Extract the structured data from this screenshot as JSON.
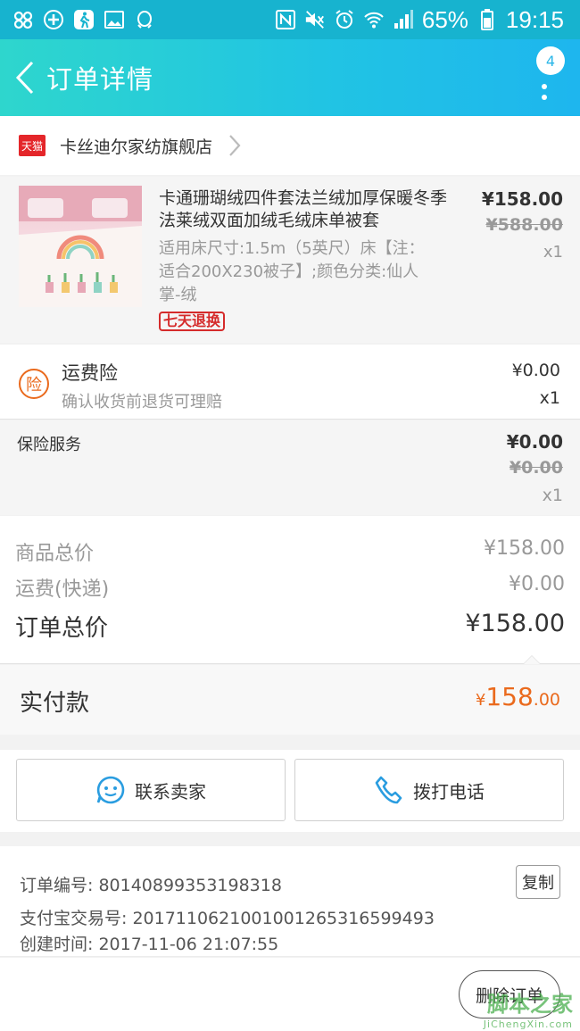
{
  "status_bar": {
    "battery": "65%",
    "time": "19:15",
    "left_icons": [
      "app-cluster-icon",
      "plus-circle-icon",
      "walker-icon",
      "image-icon",
      "qq-icon"
    ],
    "right_icons": [
      "nfc-icon",
      "mute-icon",
      "alarm-icon",
      "wifi-icon",
      "signal-icon",
      "battery-icon"
    ]
  },
  "header": {
    "title": "订单详情",
    "badge": "4"
  },
  "shop": {
    "logo_text": "天猫",
    "name": "卡丝迪尔家纺旗舰店"
  },
  "product": {
    "title": "卡通珊瑚绒四件套法兰绒加厚保暖冬季法莱绒双面加绒毛绒床单被套",
    "spec": "适用床尺寸:1.5m（5英尺）床【注：适合200X230被子】;颜色分类:仙人掌-绒",
    "tag": "七天退换",
    "price": "¥158.00",
    "original_price": "¥588.00",
    "qty": "x1"
  },
  "freight_insurance": {
    "icon_text": "险",
    "title": "运费险",
    "subtitle": "确认收货前退货可理赔",
    "price": "¥0.00",
    "qty": "x1"
  },
  "insurance_service": {
    "title": "保险服务",
    "price": "¥0.00",
    "original_price": "¥0.00",
    "qty": "x1"
  },
  "totals": {
    "goods_label": "商品总价",
    "goods_value": "¥158.00",
    "shipping_label": "运费(快递)",
    "shipping_value": "¥0.00",
    "order_label": "订单总价",
    "order_value": "¥158.00"
  },
  "paid": {
    "label": "实付款",
    "currency": "¥",
    "integer": "158",
    "decimal": ".00"
  },
  "actions": {
    "contact_seller": "联系卖家",
    "call_phone": "拨打电话"
  },
  "order_info": {
    "order_no": "订单编号: 80140899353198318",
    "alipay_no": "支付宝交易号: 2017110621001001265316599493",
    "created": "创建时间: 2017-11-06 21:07:55",
    "copy_label": "复制"
  },
  "bottom": {
    "delete_label": "删除订单",
    "watermark": "脚本之家",
    "watermark_sub": "JiChengXin.com"
  },
  "colors": {
    "accent": "#ea6a1d",
    "header_start": "#2ed6cd",
    "header_end": "#1eb6ee",
    "tmall_red": "#e4262a"
  }
}
